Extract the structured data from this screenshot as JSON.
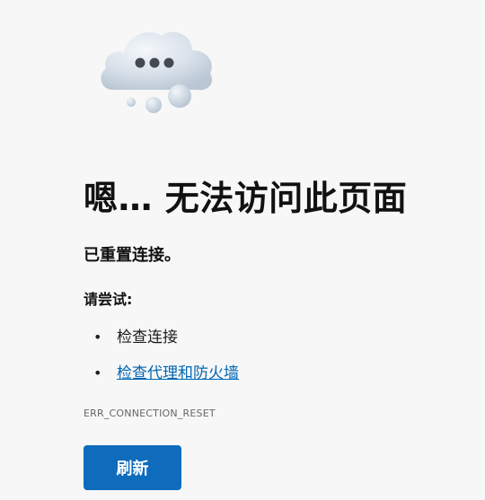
{
  "error": {
    "heading": "嗯… 无法访问此页面",
    "message": "已重置连接。",
    "try_label": "请尝试:",
    "suggestions": [
      {
        "text": "检查连接",
        "is_link": false
      },
      {
        "text": "检查代理和防火墙",
        "is_link": true
      }
    ],
    "code": "ERR_CONNECTION_RESET"
  },
  "actions": {
    "refresh_label": "刷新"
  },
  "illustration": {
    "icon": "cloud-thinking-icon"
  },
  "colors": {
    "background": "#f7f7f7",
    "accent": "#0f6cbd",
    "link": "#0066b4"
  }
}
